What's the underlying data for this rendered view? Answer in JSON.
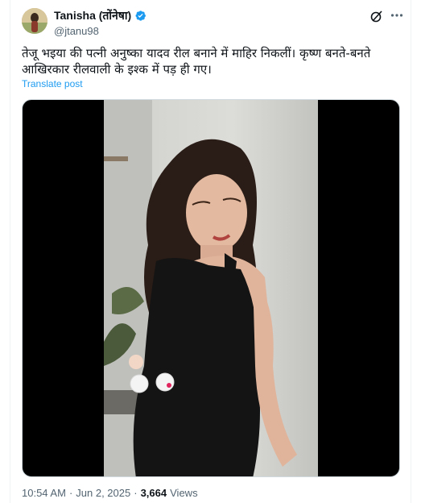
{
  "author": {
    "display_name": "Tanisha (तोंनेषा)",
    "handle": "@jtanu98",
    "verified": true
  },
  "icons": {
    "verified": "verified-badge-icon",
    "grok": "grok-icon",
    "more": "more-options-icon"
  },
  "tweet": {
    "text": "तेजू भइया की पत्नी अनुष्का यादव रील बनाने में माहिर निकलीं। कृष्ण बनते-बनते आखिरकार रीलवाली के इश्क में पड़ ही गए।",
    "translate_label": "Translate post"
  },
  "media": {
    "type": "video"
  },
  "meta": {
    "time": "10:54 AM",
    "separator": "·",
    "date": "Jun 2, 2025",
    "views_count": "3,664",
    "views_label": "Views"
  },
  "colors": {
    "accent": "#1d9bf0",
    "text_primary": "#0f1419",
    "text_secondary": "#536471",
    "border": "#eff3f4"
  }
}
